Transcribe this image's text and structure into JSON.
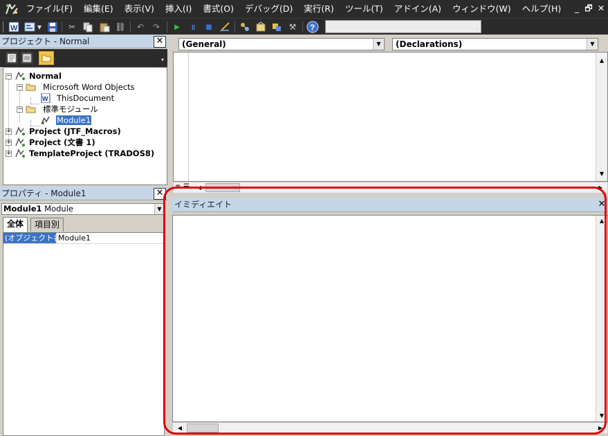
{
  "menubar": {
    "items": [
      "ファイル(F)",
      "編集(E)",
      "表示(V)",
      "挿入(I)",
      "書式(O)",
      "デバッグ(D)",
      "実行(R)",
      "ツール(T)",
      "アドイン(A)",
      "ウィンドウ(W)",
      "ヘルプ(H)"
    ],
    "window_buttons": [
      "_",
      "🗗",
      "✕"
    ]
  },
  "toolbar": {
    "icons": [
      "word-icon",
      "insert-userform-icon",
      "dropdown-icon",
      "save-icon",
      "cut-icon",
      "copy-icon",
      "paste-icon",
      "find-icon",
      "undo-icon",
      "redo-icon",
      "run-icon",
      "break-icon",
      "reset-icon",
      "design-mode-icon",
      "project-explorer-icon",
      "properties-icon",
      "object-browser-icon",
      "toolbox-icon",
      "help-icon"
    ],
    "combo_value": ""
  },
  "project_panel": {
    "title": "プロジェクト - Normal",
    "close": "✕",
    "tree": [
      {
        "label": "Normal",
        "bold": true
      },
      {
        "label": "Microsoft Word Objects"
      },
      {
        "label": "ThisDocument"
      },
      {
        "label": "標準モジュール"
      },
      {
        "label": "Module1",
        "selected": true
      },
      {
        "label": "Project (JTF_Macros)",
        "bold": true
      },
      {
        "label": "Project (文書 1)",
        "bold": true
      },
      {
        "label": "TemplateProject (TRADOS8)",
        "bold": true
      }
    ]
  },
  "properties_panel": {
    "title": "プロパティ - Module1",
    "close": "✕",
    "object_name": "Module1",
    "object_type": "Module",
    "tabs": [
      "全体",
      "項目別"
    ],
    "rows": [
      {
        "name": "(オブジェクト名)",
        "value": "Module1"
      }
    ]
  },
  "code_window": {
    "object_combo": "(General)",
    "procedure_combo": "(Declarations)"
  },
  "immediate_window": {
    "title": "イミディエイト",
    "close": "✕"
  },
  "colors": {
    "menubar_bg": "#2b2b2b",
    "panel_header": "#c5d6e8",
    "selection": "#3a73c6",
    "highlight": "#e00000"
  }
}
